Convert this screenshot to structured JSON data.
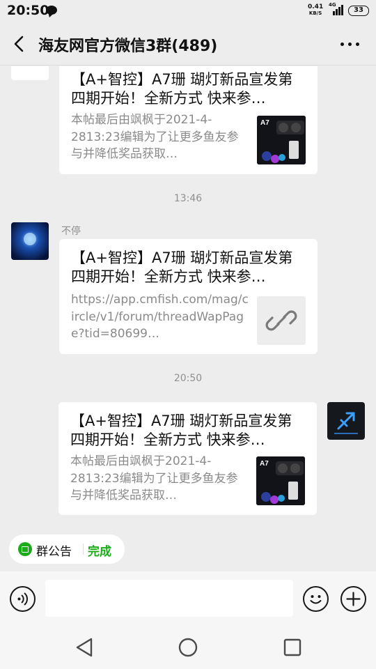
{
  "status_bar": {
    "time": "20:50",
    "net_speed_value": "0.41",
    "net_speed_unit": "KB/S",
    "network": "4G",
    "battery": "33"
  },
  "header": {
    "title": "海友网官方微信3群(489)"
  },
  "messages": [
    {
      "title": "【A+智控】A7珊 瑚灯新品宣发第四期开始！全新方式 快来参…",
      "desc": "本帖最后由飒枫于2021-4-2813:23编辑为了让更多鱼友参与并降低奖品获取…",
      "thumb_label": "A7"
    },
    {
      "timestamp": "13:46",
      "sender": "不停",
      "title": "【A+智控】A7珊 瑚灯新品宣发第四期开始！全新方式 快来参…",
      "desc": "https://app.cmfish.com/mag/circle/v1/forum/threadWapPage?tid=80699…",
      "thumb_icon": "link-icon"
    },
    {
      "timestamp": "20:50",
      "title": "【A+智控】A7珊 瑚灯新品宣发第四期开始！全新方式 快来参…",
      "desc": "本帖最后由飒枫于2021-4-2813:23编辑为了让更多鱼友参与并降低奖品获取…",
      "thumb_label": "A7"
    }
  ],
  "notice": {
    "label": "群公告",
    "action": "完成"
  },
  "colors": {
    "background": "#ededed",
    "accent_green": "#1aad19",
    "bubble": "#ffffff"
  }
}
